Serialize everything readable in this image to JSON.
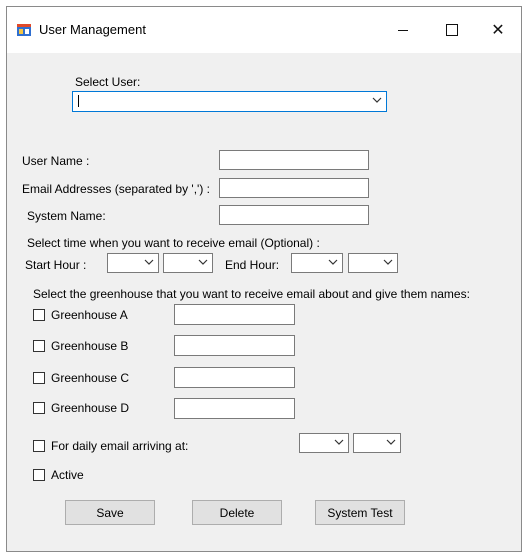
{
  "window": {
    "title": "User Management",
    "icon": "app-window-icon",
    "controls": {
      "minimize": "minimize-icon",
      "maximize": "maximize-icon",
      "close": "close-icon",
      "close_glyph": "✕"
    }
  },
  "select_user": {
    "label": "Select User:",
    "value": ""
  },
  "fields": {
    "user_name_label": "User Name :",
    "email_label": "Email Addresses (separated by ',') :",
    "system_name_label": "System Name:",
    "user_name_value": "",
    "email_value": "",
    "system_name_value": ""
  },
  "schedule": {
    "heading": "Select time when you want to receive email (Optional) :",
    "start_label": "Start Hour :",
    "end_label": "End Hour:"
  },
  "greenhouses": {
    "heading": "Select the greenhouse that you want to receive email about and give them names:",
    "items": [
      {
        "label": "Greenhouse A",
        "checked": false,
        "name": ""
      },
      {
        "label": "Greenhouse B",
        "checked": false,
        "name": ""
      },
      {
        "label": "Greenhouse C",
        "checked": false,
        "name": ""
      },
      {
        "label": "Greenhouse D",
        "checked": false,
        "name": ""
      }
    ]
  },
  "options": {
    "daily_label": "For daily email arriving at:",
    "active_label": "Active"
  },
  "buttons": {
    "save": "Save",
    "delete": "Delete",
    "system_test": "System Test"
  }
}
